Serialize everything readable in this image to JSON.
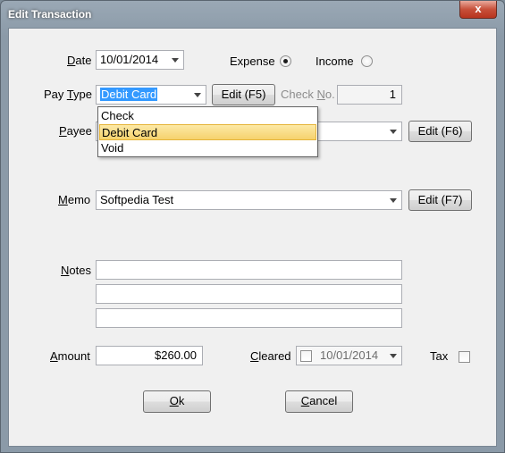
{
  "window": {
    "title": "Edit Transaction",
    "close_label": "x"
  },
  "date": {
    "label_pre": "",
    "label_ul": "D",
    "label_post": "ate",
    "value": "10/01/2014"
  },
  "type": {
    "expense_label": "Expense",
    "income_label": "Income",
    "selected": "Expense"
  },
  "paytype": {
    "label_pre": "Pay ",
    "label_ul": "T",
    "label_post": "ype",
    "value": "Debit Card",
    "edit_label": "Edit (F5)",
    "options": [
      "Check",
      "Debit Card",
      "Void"
    ],
    "selected_option": "Debit Card"
  },
  "checkno": {
    "label_pre": "Check ",
    "label_ul": "N",
    "label_post": "o.",
    "value": "1"
  },
  "payee": {
    "label_pre": "",
    "label_ul": "P",
    "label_post": "ayee",
    "value": "",
    "edit_label": "Edit (F6)"
  },
  "memo": {
    "label_pre": "",
    "label_ul": "M",
    "label_post": "emo",
    "value": "Softpedia Test",
    "edit_label": "Edit (F7)"
  },
  "notes": {
    "label_pre": "",
    "label_ul": "N",
    "label_post": "otes",
    "lines": [
      "",
      "",
      ""
    ]
  },
  "amount": {
    "label_pre": "",
    "label_ul": "A",
    "label_post": "mount",
    "value": "$260.00"
  },
  "cleared": {
    "label_pre": "",
    "label_ul": "C",
    "label_post": "leared",
    "date": "10/01/2014",
    "checked": false
  },
  "tax": {
    "label": "Tax",
    "checked": false
  },
  "buttons": {
    "ok_ul": "O",
    "ok_post": "k",
    "cancel_ul": "C",
    "cancel_post": "ancel"
  }
}
